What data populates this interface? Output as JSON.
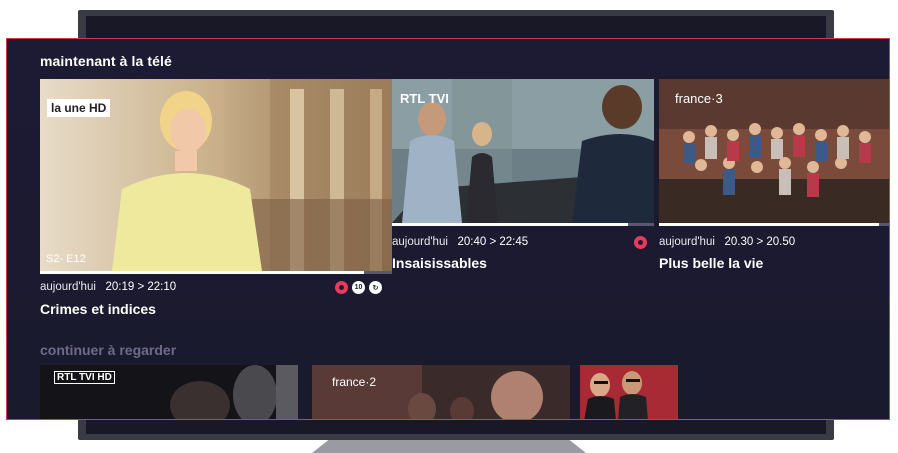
{
  "now_on_tv": {
    "section_title": "maintenant à la télé",
    "cards": [
      {
        "channel": "la une HD",
        "episode": "S2- E12",
        "day": "aujourd'hui",
        "time": "20:19 > 22:10",
        "title": "Crimes et indices",
        "progress": 0.92,
        "badges": [
          "record-icon",
          "age-10-icon",
          "replay-icon"
        ]
      },
      {
        "channel": "RTL TVI",
        "day": "aujourd'hui",
        "time": "20:40 > 22:45",
        "title": "Insaisissables",
        "progress": 0.9,
        "badges": [
          "record-icon"
        ]
      },
      {
        "channel": "france·3",
        "day": "aujourd'hui",
        "time": "20.30 > 20.50",
        "title": "Plus belle la vie",
        "progress": 0.95,
        "badges": []
      }
    ]
  },
  "continue_watching": {
    "section_title": "continuer à regarder",
    "items": [
      {
        "channel": "RTL TVI HD"
      },
      {
        "channel": "france·2"
      },
      {
        "channel": ""
      }
    ]
  },
  "colors": {
    "accent": "#e83a5a",
    "panel_border": "#d23a52",
    "background": "#1c1a32"
  },
  "age_rating": "10"
}
